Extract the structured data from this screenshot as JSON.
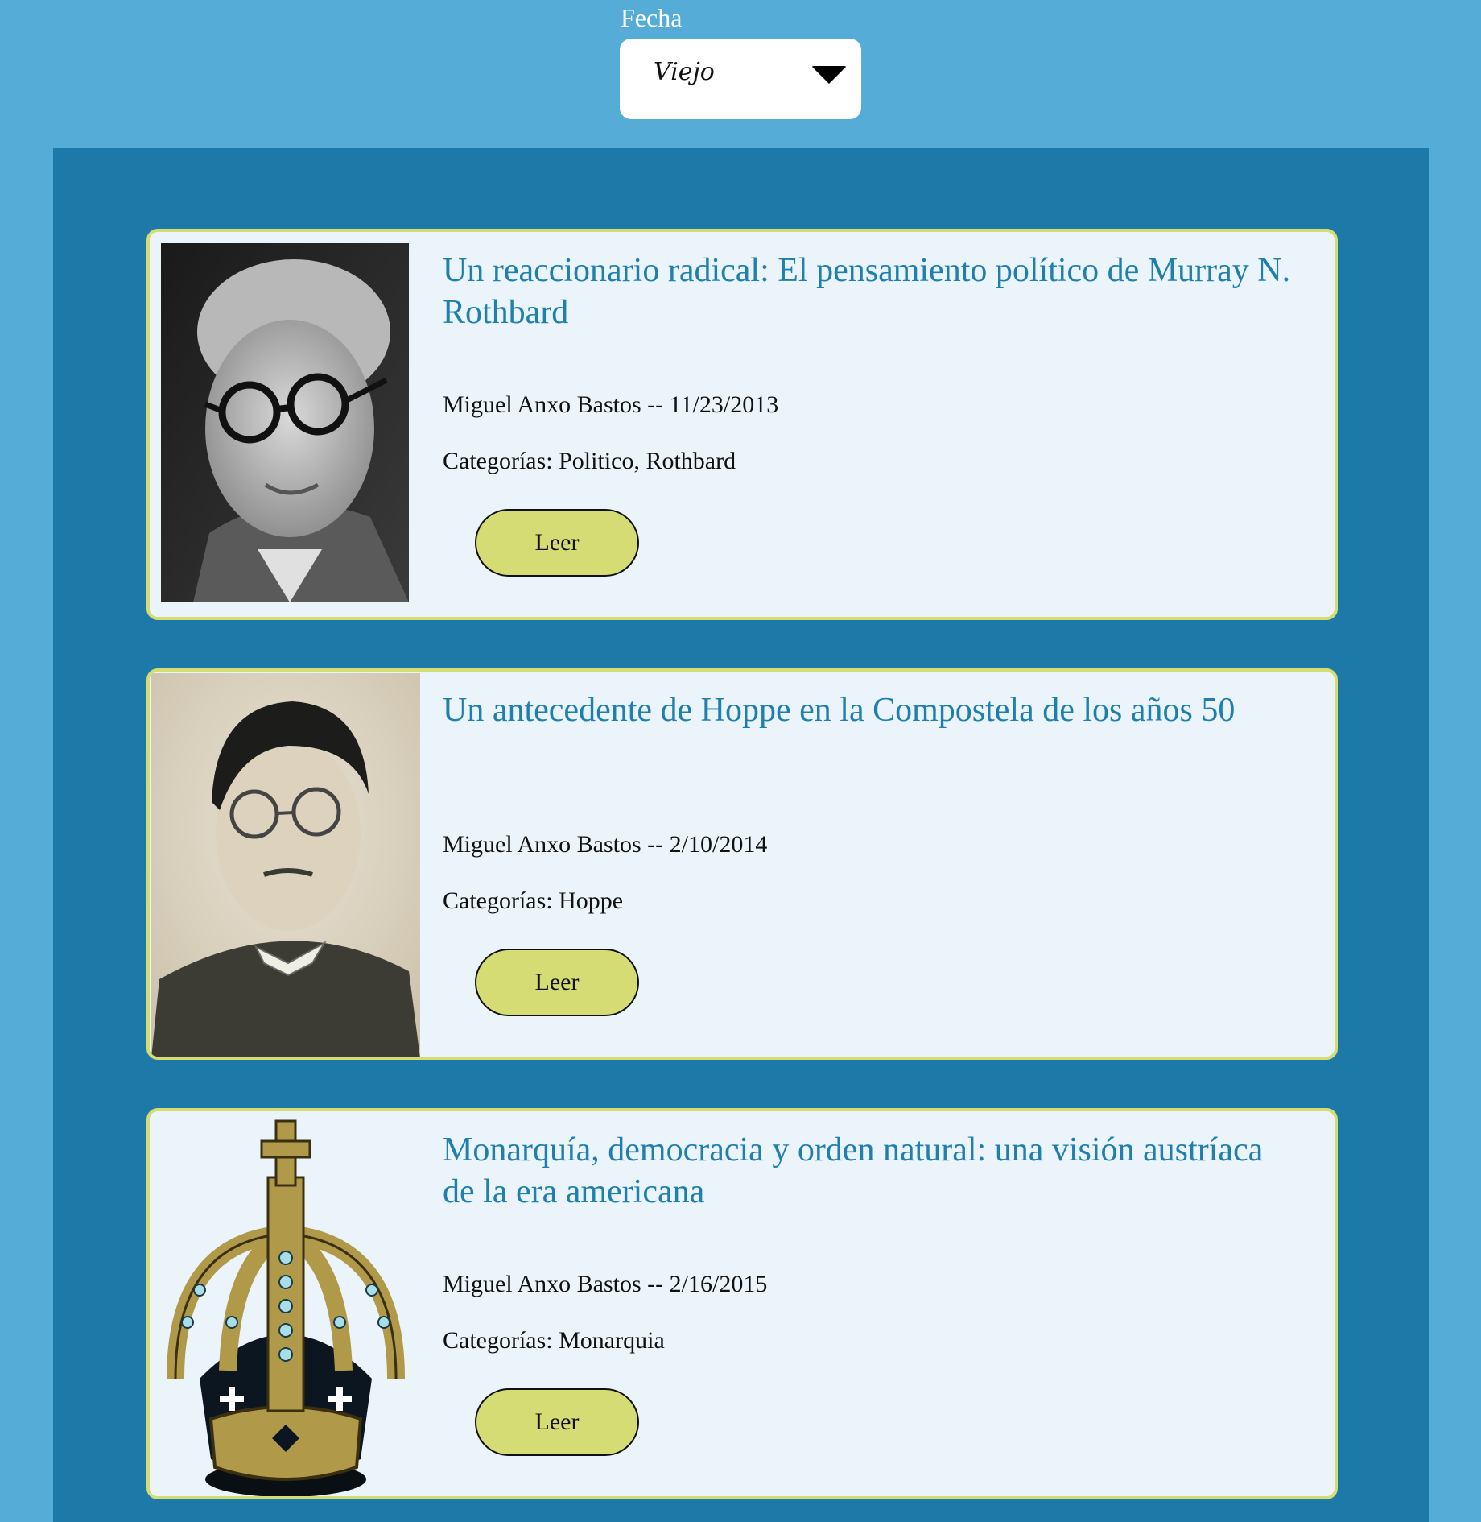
{
  "filter": {
    "label": "Fecha",
    "selected": "Viejo"
  },
  "articles": [
    {
      "title": "Un reaccionario radical: El pensamiento político de Murray N. Rothbard",
      "meta": "Miguel Anxo Bastos -- 11/23/2013",
      "categories": "Categorías: Politico, Rothbard",
      "button": "Leer",
      "image": "portrait-photo-bw"
    },
    {
      "title": "Un antecedente de Hoppe en la Compostela de los años 50",
      "meta": "Miguel Anxo Bastos -- 2/10/2014",
      "categories": "Categorías: Hoppe",
      "button": "Leer",
      "image": "portrait-sketch-sepia"
    },
    {
      "title": "Monarquía, democracia y orden natural: una visión austríaca de la era americana",
      "meta": "Miguel Anxo Bastos -- 2/16/2015",
      "categories": "Categorías: Monarquia",
      "button": "Leer",
      "image": "crown-illustration"
    }
  ],
  "colors": {
    "page_bg": "#55acd6",
    "panel_bg": "#1d79a8",
    "card_bg": "#eaf4fa",
    "accent": "#d4dc72",
    "title": "#1f7fae"
  }
}
